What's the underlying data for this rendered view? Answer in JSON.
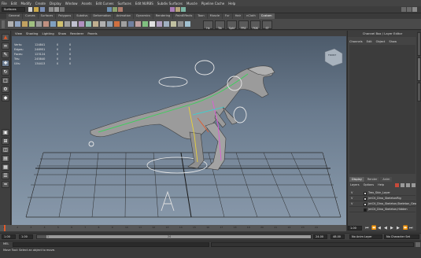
{
  "menubar": {
    "items": [
      "File",
      "Edit",
      "Modify",
      "Create",
      "Display",
      "Window",
      "Assets",
      "Edit Curves",
      "Surfaces",
      "Edit NURBS",
      "Subdiv Surfaces",
      "Muscle",
      "Pipeline Cache",
      "Help"
    ]
  },
  "statusline": {
    "mode": "Surfaces"
  },
  "shelf": {
    "tabs": [
      "General",
      "Curves",
      "Surfaces",
      "Polygons",
      "Subdivs",
      "Deformation",
      "Animation",
      "Dynamics",
      "Rendering",
      "PaintEffects",
      "Toon",
      "Muscle",
      "Fur",
      "Hair",
      "nCloth",
      "Custom"
    ],
    "active_index": 15,
    "labels": [
      "Hx",
      "Trk",
      "Spkt",
      "PRS",
      "FKIK",
      "ST"
    ]
  },
  "viewport": {
    "menu": [
      "View",
      "Shading",
      "Lighting",
      "Show",
      "Renderer",
      "Panels"
    ],
    "view_cube_label": "FRONT",
    "hud": [
      {
        "label": "Verts:",
        "value": "124841",
        "a": "0",
        "b": "0"
      },
      {
        "label": "Edges:",
        "value": "246951",
        "a": "0",
        "b": "0"
      },
      {
        "label": "Faces:",
        "value": "123124",
        "a": "0",
        "b": "0"
      },
      {
        "label": "Tris:",
        "value": "245840",
        "a": "0",
        "b": "0"
      },
      {
        "label": "UVs:",
        "value": "134413",
        "a": "0",
        "b": "0"
      }
    ]
  },
  "right_panel": {
    "title": "Channel Box / Layer Editor",
    "menu": [
      "Channels",
      "Edit",
      "Object",
      "Show"
    ],
    "layer_tabs": [
      "Display",
      "Render",
      "Anim"
    ],
    "layer_menu": [
      "Layers",
      "Options",
      "Help"
    ],
    "layers": [
      {
        "visible": "V",
        "name": "Trex_Skin_Layer",
        "swatch": "#cfcfcf"
      },
      {
        "visible": "V",
        "name": "JntCtl_Dino_SkeletonRig",
        "swatch": "#cfcfcf"
      },
      {
        "visible": "V",
        "name": "JntCtl_Dino_Skeleton,Skeleton_Geo",
        "swatch": "#cfcfcf"
      },
      {
        "visible": "",
        "name": "JntCtl_Dino_Skeleton,Hidden",
        "swatch": "#1a1a1a"
      }
    ]
  },
  "timeline": {
    "ticks": [
      "1",
      "2",
      "3",
      "4",
      "5",
      "6",
      "7",
      "8",
      "9",
      "10",
      "11",
      "12",
      "13",
      "14",
      "15",
      "16",
      "17",
      "18",
      "19",
      "20",
      "21",
      "22",
      "23",
      "24"
    ],
    "current_frame": "1.00"
  },
  "range": {
    "start": "1.00",
    "inner_start": "1.00",
    "range_start_label": "1",
    "range_end_label": "24",
    "inner_end": "24.00",
    "end": "48.00",
    "anim_layer": "No Anim Layer",
    "char_set": "No Character Set"
  },
  "cmdline": {
    "label": "MEL"
  },
  "helpline": {
    "text": "Move Tool: Select an object to move."
  },
  "colors": {
    "accent": "#e05a2b",
    "viewport_top": "#4d5b6b",
    "viewport_bottom": "#8a9bac"
  }
}
